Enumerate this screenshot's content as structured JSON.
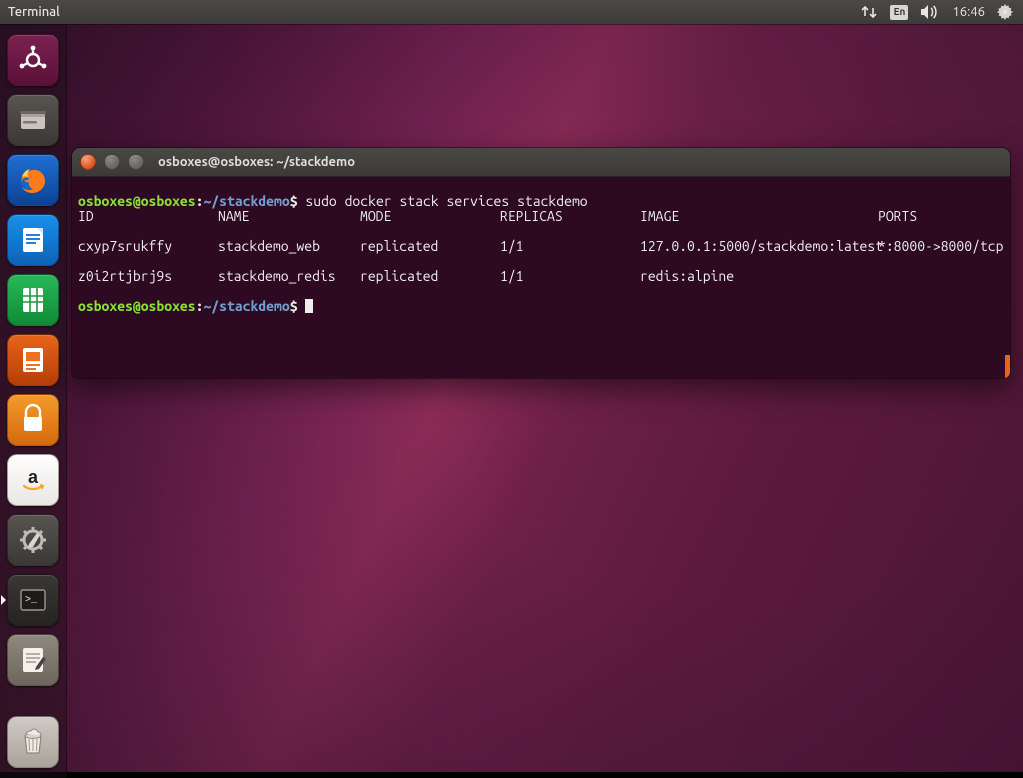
{
  "panel": {
    "app_title": "Terminal",
    "lang": "En",
    "clock": "16:46"
  },
  "launcher": {
    "items": [
      {
        "name": "dash",
        "label": "Search your computer"
      },
      {
        "name": "files",
        "label": "Files"
      },
      {
        "name": "firefox",
        "label": "Firefox Web Browser"
      },
      {
        "name": "writer",
        "label": "LibreOffice Writer"
      },
      {
        "name": "calc",
        "label": "LibreOffice Calc"
      },
      {
        "name": "impress",
        "label": "LibreOffice Impress"
      },
      {
        "name": "software",
        "label": "Ubuntu Software"
      },
      {
        "name": "amazon",
        "label": "Amazon"
      },
      {
        "name": "settings",
        "label": "System Settings"
      },
      {
        "name": "terminal",
        "label": "Terminal"
      },
      {
        "name": "texteditor",
        "label": "Text Editor"
      }
    ],
    "trash_label": "Trash"
  },
  "terminal": {
    "window_title": "osboxes@osboxes: ~/stackdemo",
    "prompt": {
      "user": "osboxes@osboxes",
      "sep": ":",
      "path": "~/stackdemo",
      "sigil": "$"
    },
    "command": "sudo docker stack services stackdemo",
    "header": {
      "id": "ID",
      "name": "NAME",
      "mode": "MODE",
      "replicas": "REPLICAS",
      "image": "IMAGE",
      "ports": "PORTS"
    },
    "rows": [
      {
        "id": "cxyp7srukffy",
        "name": "stackdemo_web",
        "mode": "replicated",
        "replicas": "1/1",
        "image": "127.0.0.1:5000/stackdemo:latest",
        "ports": "*:8000->8000/tcp"
      },
      {
        "id": "z0i2rtjbrj9s",
        "name": "stackdemo_redis",
        "mode": "replicated",
        "replicas": "1/1",
        "image": "redis:alpine",
        "ports": ""
      }
    ]
  }
}
